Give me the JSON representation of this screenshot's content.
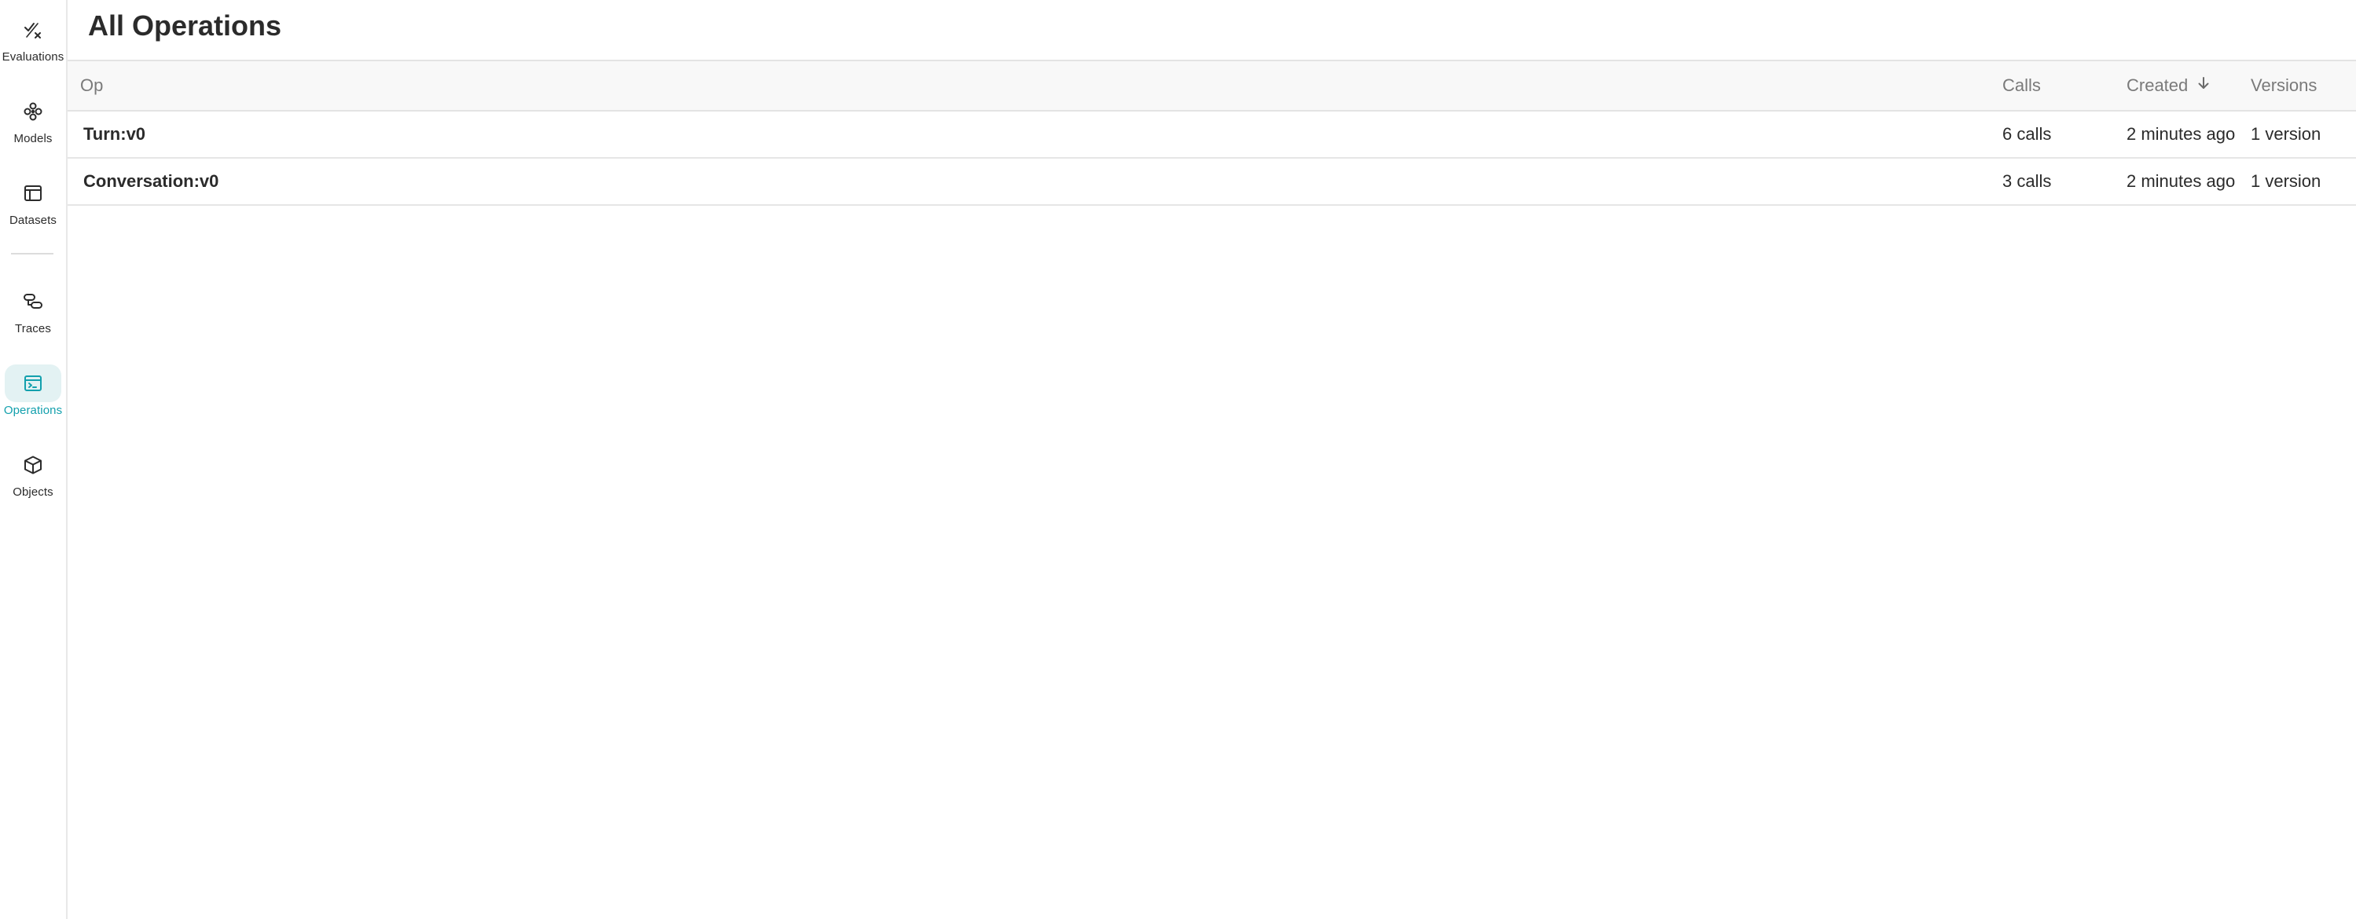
{
  "sidebar": {
    "items": [
      {
        "label": "Evaluations",
        "icon": "evaluations-icon",
        "active": false
      },
      {
        "label": "Models",
        "icon": "models-icon",
        "active": false
      },
      {
        "label": "Datasets",
        "icon": "datasets-icon",
        "active": false
      },
      {
        "label": "Traces",
        "icon": "traces-icon",
        "active": false
      },
      {
        "label": "Operations",
        "icon": "operations-icon",
        "active": true
      },
      {
        "label": "Objects",
        "icon": "objects-icon",
        "active": false
      }
    ]
  },
  "header": {
    "title": "All Operations"
  },
  "table": {
    "columns": {
      "op": "Op",
      "calls": "Calls",
      "created": "Created",
      "versions": "Versions"
    },
    "sort": {
      "column": "created",
      "direction": "descending",
      "icon": "arrow-down-icon"
    },
    "rows": [
      {
        "op": "Turn:v0",
        "calls": "6 calls",
        "created": "2 minutes ago",
        "versions": "1 version"
      },
      {
        "op": "Conversation:v0",
        "calls": "3 calls",
        "created": "2 minutes ago",
        "versions": "1 version"
      }
    ]
  },
  "colors": {
    "accent": "#13a0ad",
    "active_bg": "#e3f2f3",
    "header_bg": "#f8f8f8",
    "text": "#2b2b2b",
    "muted_text": "#7a7a7a",
    "border": "#e3e3e3"
  }
}
